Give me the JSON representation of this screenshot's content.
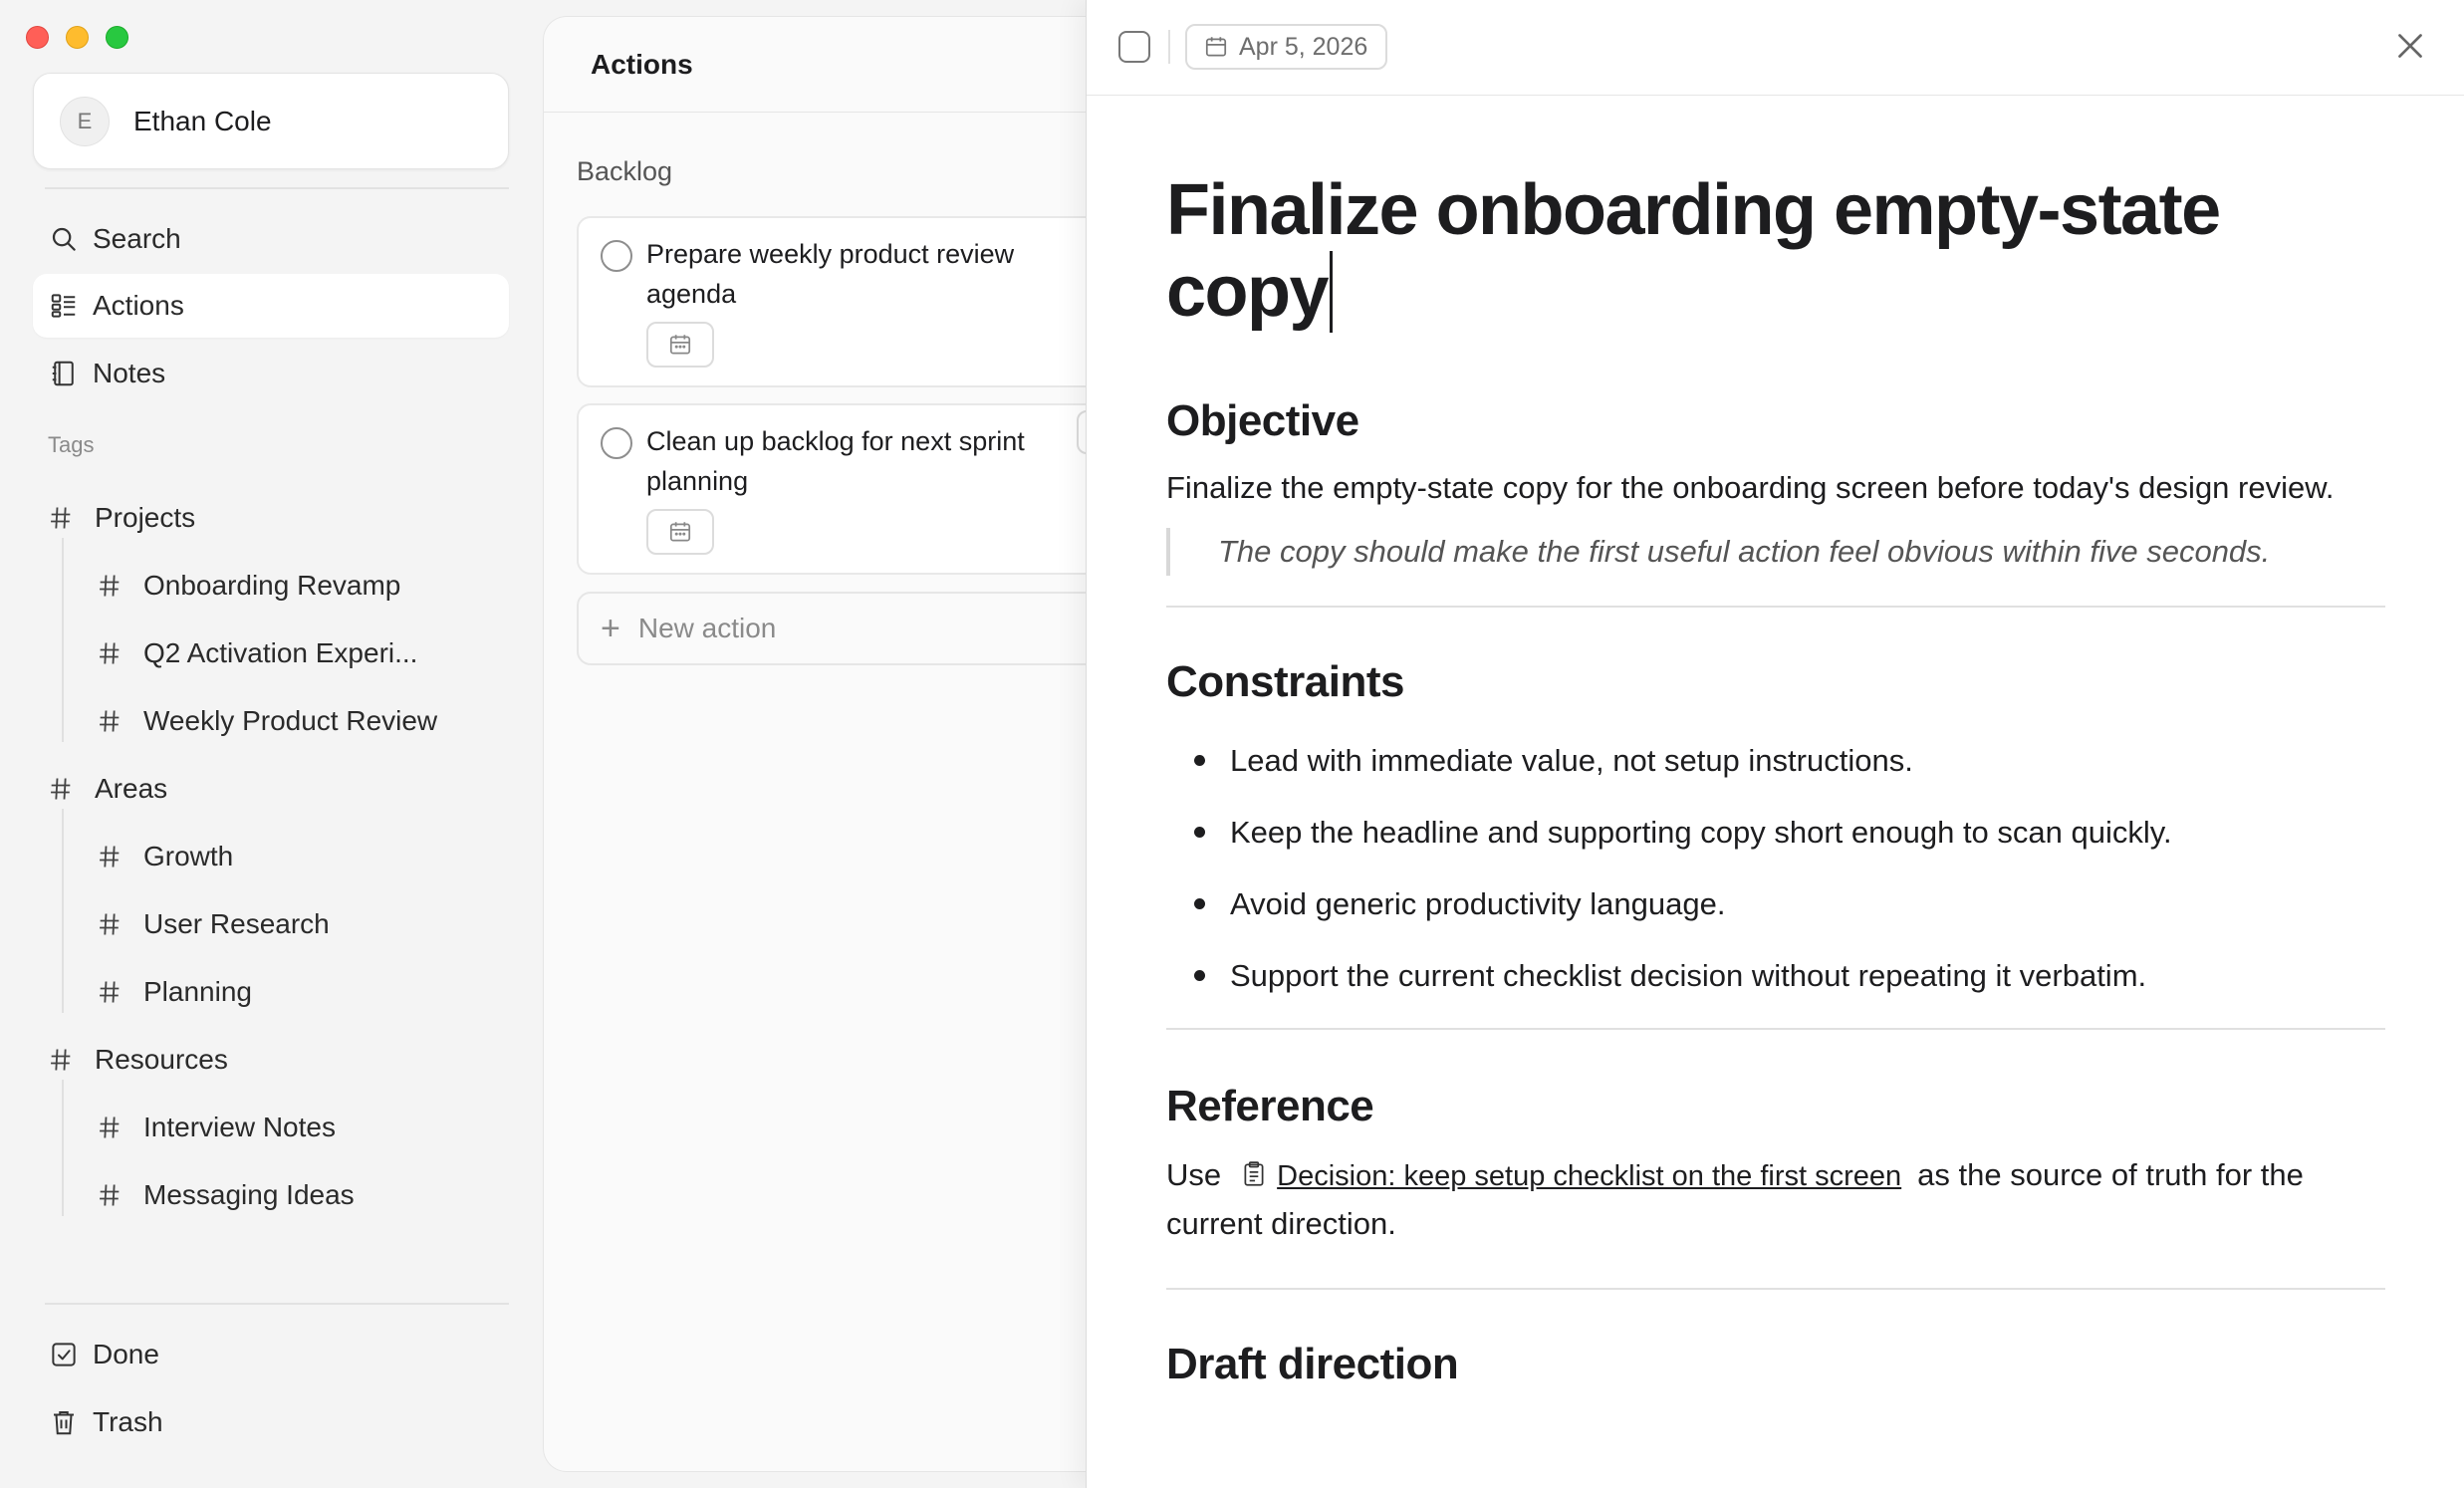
{
  "user": {
    "initial": "E",
    "name": "Ethan Cole"
  },
  "nav": {
    "search": "Search",
    "actions": "Actions",
    "notes": "Notes",
    "done": "Done",
    "trash": "Trash"
  },
  "tags_label": "Tags",
  "tags": {
    "projects": {
      "label": "Projects",
      "children": [
        "Onboarding Revamp",
        "Q2 Activation Experi...",
        "Weekly Product Review"
      ]
    },
    "areas": {
      "label": "Areas",
      "children": [
        "Growth",
        "User Research",
        "Planning"
      ]
    },
    "resources": {
      "label": "Resources",
      "children": [
        "Interview Notes",
        "Messaging Ideas"
      ]
    }
  },
  "actions_panel": {
    "title": "Actions",
    "group": "Backlog",
    "items": [
      {
        "title": "Prepare weekly product review agenda"
      },
      {
        "title": "Clean up backlog for next sprint planning"
      }
    ],
    "new_action": "New action"
  },
  "detail": {
    "date": "Apr 5, 2026",
    "title": "Finalize onboarding empty-state copy",
    "objective_heading": "Objective",
    "objective_text": "Finalize the empty-state copy for the onboarding screen before today's design review.",
    "quote": "The copy should make the first useful action feel obvious within five seconds.",
    "constraints_heading": "Constraints",
    "constraints": [
      "Lead with immediate value, not setup instructions.",
      "Keep the headline and supporting copy short enough to scan quickly.",
      "Avoid generic productivity language.",
      "Support the current checklist decision without repeating it verbatim."
    ],
    "reference_heading": "Reference",
    "reference_prefix": "Use",
    "reference_link": "Decision: keep setup checklist on the first screen",
    "reference_suffix": "as the source of truth for the current direction.",
    "next_heading": "Draft direction"
  },
  "colors": {
    "accent_close": "#ff5f57",
    "accent_min": "#febc2e",
    "accent_max": "#28c840"
  }
}
